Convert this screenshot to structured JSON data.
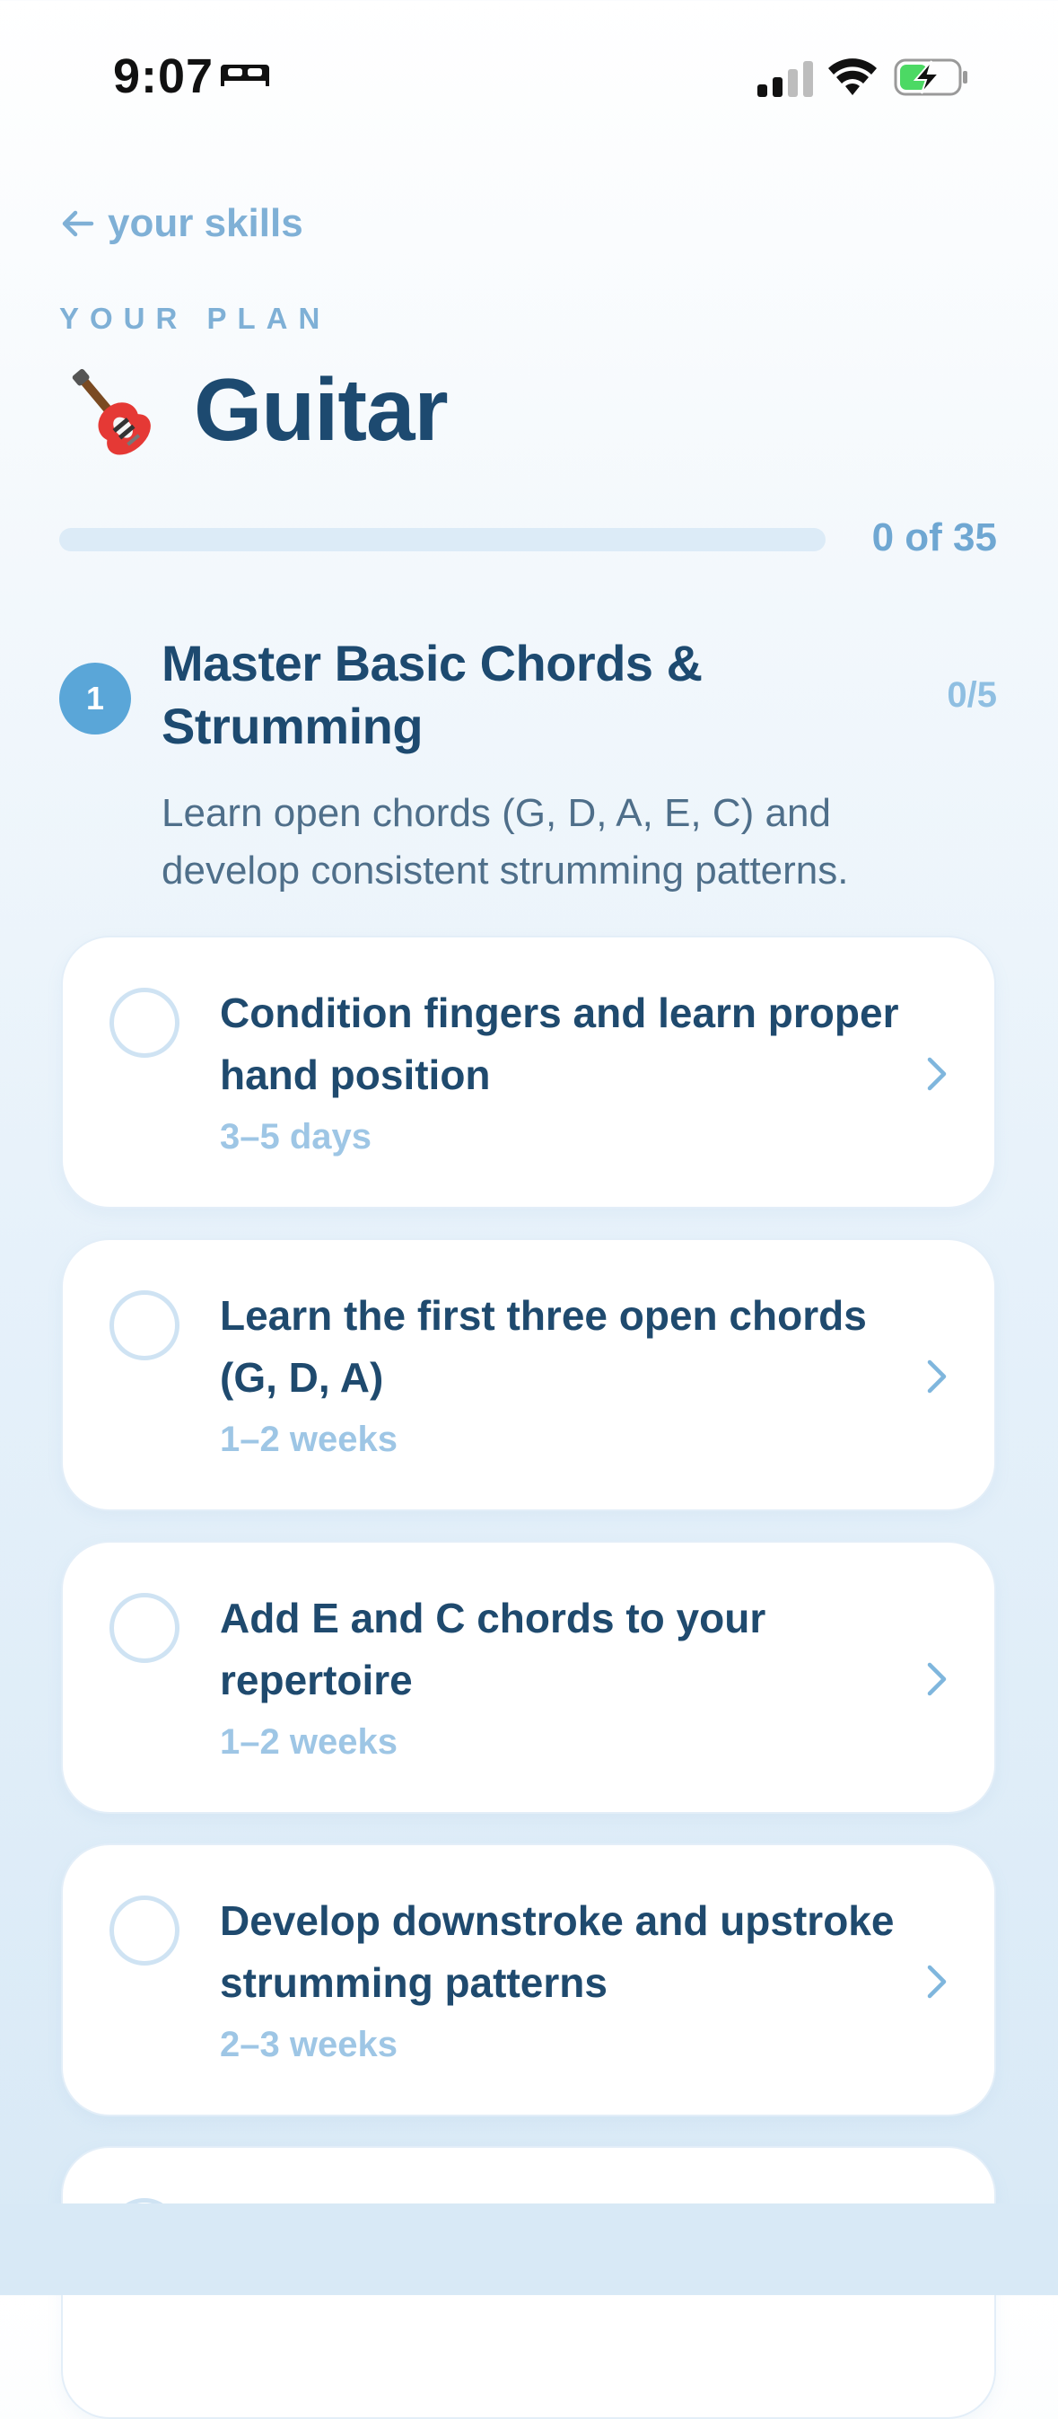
{
  "status_bar": {
    "time": "9:07"
  },
  "nav": {
    "back_label": "your skills"
  },
  "header": {
    "eyebrow": "YOUR PLAN",
    "title": "Guitar"
  },
  "progress": {
    "label": "0 of 35",
    "fraction": 0
  },
  "phase": {
    "number": "1",
    "title": "Master Basic Chords & Strumming",
    "count": "0/5",
    "description": "Learn open chords (G, D, A, E, C) and develop consistent strumming patterns."
  },
  "steps": [
    {
      "title": "Condition fingers and learn proper hand position",
      "duration": "3–5 days"
    },
    {
      "title": "Learn the first three open chords (G, D, A)",
      "duration": "1–2 weeks"
    },
    {
      "title": "Add E and C chords to your repertoire",
      "duration": "1–2 weeks"
    },
    {
      "title": "Develop downstroke and upstroke strumming patterns",
      "duration": "2–3 weeks"
    }
  ],
  "colors": {
    "accent": "#5aa6d8",
    "title": "#1d4a70",
    "muted": "#7fb0d6",
    "charging": "#4cd964"
  }
}
